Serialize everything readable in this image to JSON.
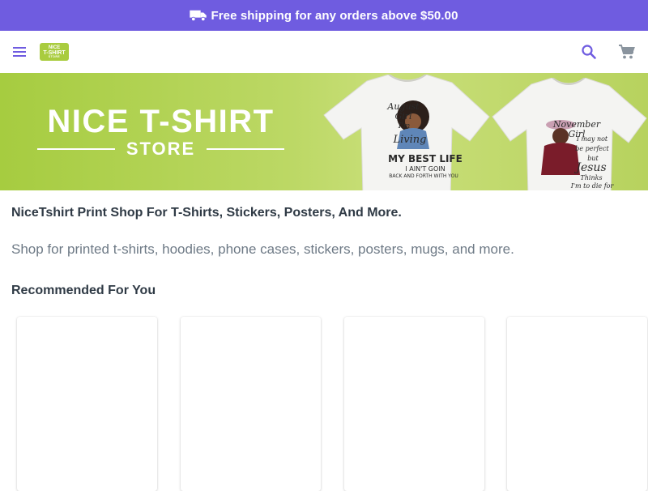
{
  "promo": {
    "text": "Free shipping for any orders above $50.00",
    "icon": "truck-icon",
    "background": "#6f5ce0"
  },
  "header": {
    "menu_icon": "hamburger-menu-icon",
    "logo": {
      "line1": "NICE",
      "line2": "T-SHIRT",
      "line3": "STORE",
      "color": "#a9cc3f"
    },
    "search_icon": "search-icon",
    "cart_icon": "cart-icon",
    "icon_color": "#6f5ce0"
  },
  "hero": {
    "title": "NICE T-SHIRT",
    "subtitle": "STORE",
    "shirt1": {
      "l1": "August Girl",
      "l2": "I'm",
      "l3": "Living",
      "l4": "MY BEST LIFE",
      "l5": "I AIN'T GOIN",
      "l6": "BACK AND FORTH WITH YOU"
    },
    "shirt2": {
      "l1": "November Girl",
      "l2": "I may not",
      "l3": "be perfect",
      "l4": "but",
      "l5": "Jesus",
      "l6": "Thinks",
      "l7": "I'm to die for"
    }
  },
  "intro": {
    "title": "NiceTshirt Print Shop For T-Shirts, Stickers, Posters, And More.",
    "description": "Shop for printed t-shirts, hoodies, phone cases, stickers, posters, mugs, and more."
  },
  "recommended": {
    "title": "Recommended For You",
    "cards": 4
  }
}
